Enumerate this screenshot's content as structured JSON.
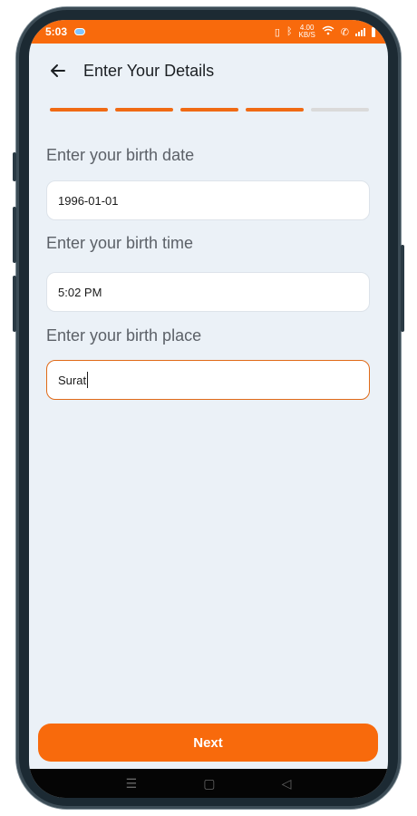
{
  "status_bar": {
    "time": "5:03",
    "network_speed": "4.00",
    "network_unit": "KB/S"
  },
  "header": {
    "title": "Enter Your Details"
  },
  "stepper": {
    "total_steps": 5,
    "completed_steps": 4
  },
  "form": {
    "birth_date": {
      "label": "Enter your birth date",
      "value": "1996-01-01"
    },
    "birth_time": {
      "label": "Enter your birth time",
      "value": "5:02 PM"
    },
    "birth_place": {
      "label": "Enter your birth place",
      "value": "Surat"
    }
  },
  "actions": {
    "next_label": "Next"
  },
  "system_nav": {
    "menu_icon": "☰",
    "home_icon": "▢",
    "back_icon": "◁"
  },
  "colors": {
    "accent": "#f86a0c",
    "background": "#ebf1f7"
  }
}
